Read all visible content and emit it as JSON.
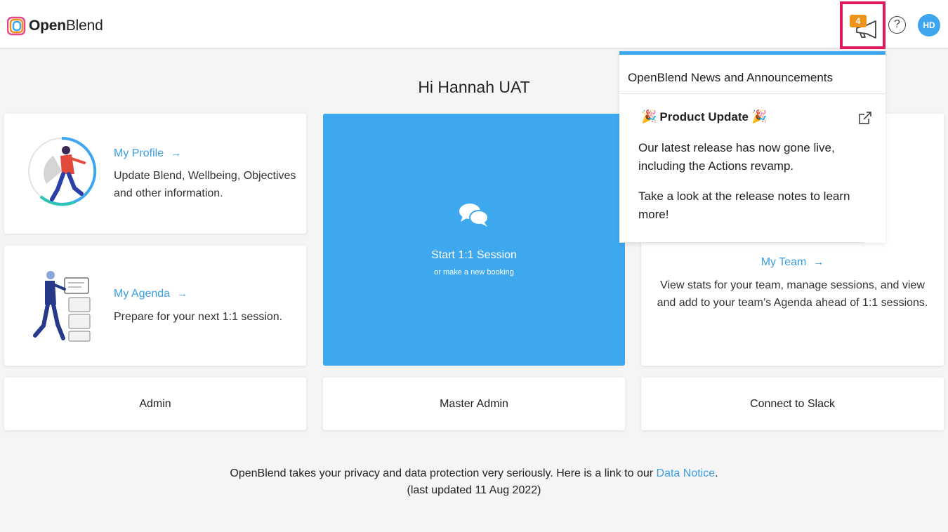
{
  "header": {
    "logo_text_bold": "Open",
    "logo_text_light": "Blend",
    "news_badge_count": "4",
    "help_label": "?",
    "avatar_initials": "HD"
  },
  "greeting": "Hi Hannah UAT",
  "cards": {
    "profile": {
      "link": "My Profile",
      "arrow": "→",
      "description": "Update Blend, Wellbeing, Objectives and other information."
    },
    "agenda": {
      "link": "My Agenda",
      "arrow": "→",
      "description": "Prepare for your next 1:1 session."
    },
    "session": {
      "title": "Start 1:1 Session",
      "subtitle": "or make a new booking"
    },
    "team": {
      "link": "My Team",
      "arrow": "→",
      "description": "View stats for your team, manage sessions, and view and add to your team’s Agenda ahead of 1:1 sessions."
    },
    "admin": {
      "label": "Admin"
    },
    "master_admin": {
      "label": "Master Admin"
    },
    "slack": {
      "label": "Connect to Slack"
    }
  },
  "footer": {
    "text_before": "OpenBlend takes your privacy and data protection very seriously. Here is a link to our ",
    "link": "Data Notice",
    "text_after": ".",
    "updated": "(last updated 11 Aug 2022)"
  },
  "news_dropdown": {
    "title": "OpenBlend News and Announcements",
    "item_heading": "Product Update",
    "item_emoji": "🎉",
    "paragraph1": "Our latest release has now gone live, including the Actions revamp.",
    "paragraph2": "Take a look at the release notes to learn more!"
  },
  "colors": {
    "accent": "#3ea6ee",
    "highlight": "#e0195a",
    "badge": "#f0931a"
  }
}
